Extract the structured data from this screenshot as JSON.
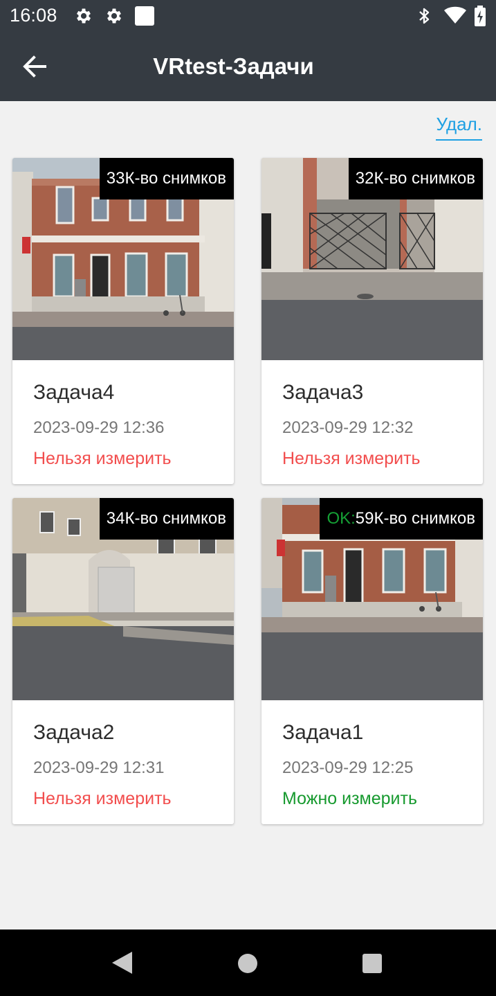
{
  "status_bar": {
    "time": "16:08",
    "icons": [
      "gear-icon",
      "gear-icon",
      "blank-square-icon",
      "bluetooth-icon",
      "wifi-icon",
      "battery-charging-icon"
    ]
  },
  "app_bar": {
    "title": "VRtest-Задачи",
    "back_icon": "arrow-left-icon"
  },
  "delete_label": "Удал.",
  "tasks": [
    {
      "title": "Задача4",
      "date": "2023-09-29 12:36",
      "status": "Нельзя измерить",
      "status_color": "#f24d4d",
      "badge_prefix": "",
      "badge_text": "33К-во снимков"
    },
    {
      "title": "Задача3",
      "date": "2023-09-29 12:32",
      "status": "Нельзя измерить",
      "status_color": "#f24d4d",
      "badge_prefix": "",
      "badge_text": "32К-во снимков"
    },
    {
      "title": "Задача2",
      "date": "2023-09-29 12:31",
      "status": "Нельзя измерить",
      "status_color": "#f24d4d",
      "badge_prefix": "",
      "badge_text": "34К-во снимков"
    },
    {
      "title": "Задача1",
      "date": "2023-09-29 12:25",
      "status": "Можно измерить",
      "status_color": "#179a2f",
      "badge_prefix": "OK:",
      "badge_text": "59К-во снимков"
    }
  ],
  "nav_bar": {
    "icons": [
      "nav-back-icon",
      "nav-home-icon",
      "nav-recents-icon"
    ]
  },
  "colors": {
    "app_bar": "#353b42",
    "accent": "#1ea0e3",
    "error": "#f24d4d",
    "success": "#179a2f"
  }
}
